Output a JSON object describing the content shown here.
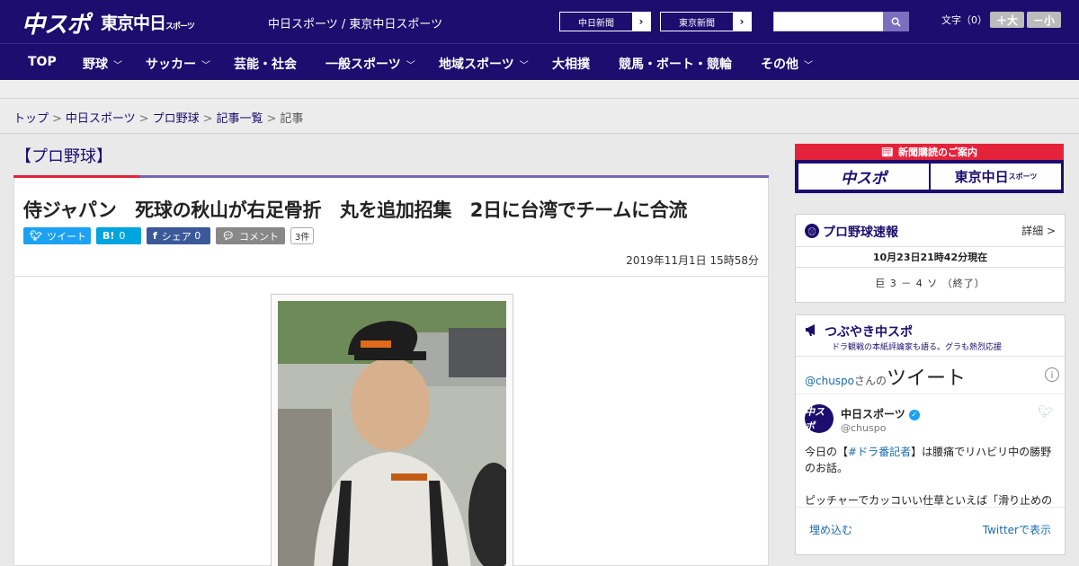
{
  "header": {
    "logo_chuspo": "中スポ",
    "logo_tokyo": "東京中日",
    "logo_tokyo_small": "スポーツ",
    "site_name": "中日スポーツ / 東京中日スポーツ",
    "paper_links": [
      "中日新聞",
      "東京新聞"
    ],
    "search_placeholder": "",
    "font_size_label": "文字（0）",
    "font_plus": "＋大",
    "font_minus": "－小"
  },
  "nav": {
    "items": [
      {
        "label": "TOP",
        "dropdown": false
      },
      {
        "label": "野球",
        "dropdown": true
      },
      {
        "label": "サッカー",
        "dropdown": true
      },
      {
        "label": "芸能・社会",
        "dropdown": false
      },
      {
        "label": "一般スポーツ",
        "dropdown": true
      },
      {
        "label": "地域スポーツ",
        "dropdown": true
      },
      {
        "label": "大相撲",
        "dropdown": false
      },
      {
        "label": "競馬・ボート・競輪",
        "dropdown": false
      },
      {
        "label": "その他",
        "dropdown": true
      }
    ]
  },
  "breadcrumb": {
    "items": [
      "トップ",
      "中日スポーツ",
      "プロ野球",
      "記事一覧"
    ],
    "current": "記事",
    "separator": ">"
  },
  "article": {
    "category": "【プロ野球】",
    "headline": "侍ジャパン　死球の秋山が右足骨折　丸を追加招集　2日に台湾でチームに合流",
    "share": {
      "tweet": "ツイート",
      "hatena_icon": "B!",
      "hatena_count": "0",
      "facebook_share": "シェア",
      "facebook_count": "0",
      "comment": "コメント",
      "comment_count": "3件"
    },
    "date": "2019年11月1日 15時58分"
  },
  "sidebar": {
    "subscribe_title": "新聞購読のご案内",
    "subscribe_chuspo": "中スポ",
    "subscribe_tokyo": "東京中日",
    "subscribe_tokyo_small": "スポーツ",
    "baseball": {
      "title": "プロ野球速報",
      "detail": "詳細 >",
      "time": "10月23日21時42分現在",
      "score": "巨 3 － 4 ソ （終了）"
    },
    "twitter": {
      "title": "つぶやき中スポ",
      "subtitle": "ドラ観戦の本紙評論家も語る。グラも熱烈応援",
      "handle": "@chuspo",
      "handle_suffix": "さんの",
      "widget_title": "ツイート",
      "account_name": "中日スポーツ",
      "screen_name": "@chuspo",
      "avatar_text": "中スポ",
      "tweet_pre": "今日の【",
      "tweet_hashtag": "#ドラ番記者",
      "tweet_post": "】は腰痛でリハビリ中の勝野のお話。",
      "tweet_line2": "ピッチャーでカッコいい仕草といえば「滑り止めの",
      "embed": "埋め込む",
      "view_on_twitter": "Twitterで表示"
    }
  },
  "colors": {
    "brand_navy": "#1c0d6e",
    "accent_red": "#e4233a",
    "accent_purple": "#7766b0",
    "twitter_blue": "#1da1f2",
    "facebook_blue": "#3b5998",
    "hatena_blue": "#00a4de"
  }
}
